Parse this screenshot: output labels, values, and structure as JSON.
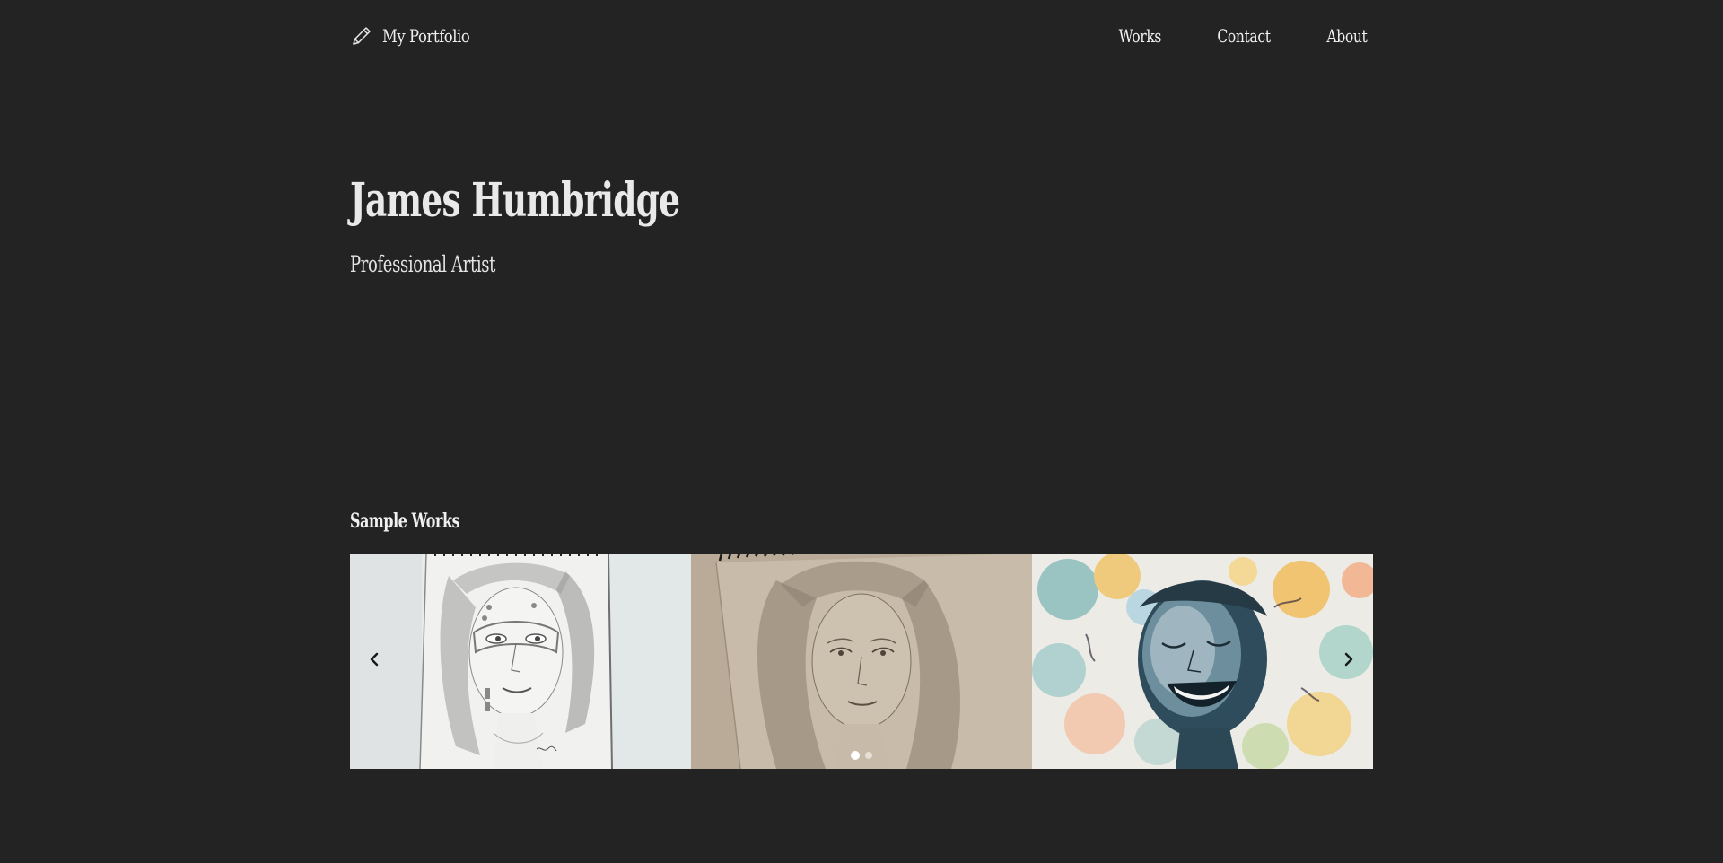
{
  "header": {
    "brand_icon": "pencil-icon",
    "brand_text": "My Portfolio",
    "nav": [
      {
        "label": "Works"
      },
      {
        "label": "Contact"
      },
      {
        "label": "About"
      }
    ]
  },
  "hero": {
    "title": "James Humbridge",
    "subtitle": "Professional Artist"
  },
  "sample_works": {
    "title": "Sample Works",
    "slides": [
      {
        "alt": "Pencil sketch of woman with face paint"
      },
      {
        "alt": "Pencil sketch of woman portrait"
      },
      {
        "alt": "Spray paint portrait of laughing woman"
      }
    ],
    "prev_icon": "chevron-left-icon",
    "next_icon": "chevron-right-icon",
    "dots_total": 2,
    "dots_active_index": 0
  },
  "colors": {
    "background": "#232323",
    "text": "#f0f0f0"
  }
}
